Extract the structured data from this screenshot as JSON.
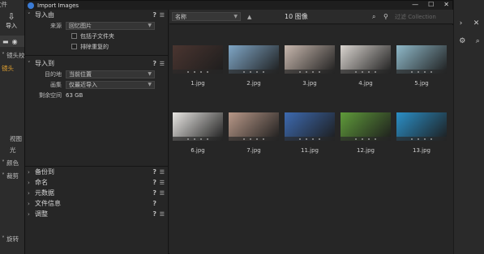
{
  "background_app": {
    "top_label": "文件",
    "import_label": "导入",
    "lens_label": "镜头校",
    "tab_label": "镜头",
    "side_labels": [
      "视图",
      "光",
      "颜色",
      "裁剪",
      "旋转"
    ]
  },
  "dialog": {
    "title": "Import Images",
    "window_buttons": [
      "—",
      "☐",
      "✕"
    ]
  },
  "left_panel": {
    "import_from": {
      "header": "导入由",
      "source_label": "来源",
      "source_value": "回忆图片",
      "include_subfolders": "包括子文件夹",
      "exclude_duplicates": "排除重复的"
    },
    "import_to": {
      "header": "导入到",
      "destination_label": "目的地",
      "destination_value": "当前位置",
      "album_label": "画集",
      "album_value": "仅最近导入",
      "free_space_label": "剩余空间",
      "free_space_value": "63 GB"
    },
    "collapsed_sections": [
      "备份到",
      "命名",
      "元数据",
      "文件信息",
      "调整"
    ]
  },
  "toolbar": {
    "sort_value": "名称",
    "sort_direction_icon": "▲",
    "count": "10 图像",
    "search_placeholder": "过滤 Collection"
  },
  "thumbnails": [
    {
      "name": "1.jpg",
      "color": "#4a3530"
    },
    {
      "name": "2.jpg",
      "color": "#7fa6c6"
    },
    {
      "name": "3.jpg",
      "color": "#c8b8ae"
    },
    {
      "name": "4.jpg",
      "color": "#d9d4cf"
    },
    {
      "name": "5.jpg",
      "color": "#8fb9c9"
    },
    {
      "name": "6.jpg",
      "color": "#e8e6e3"
    },
    {
      "name": "7.jpg",
      "color": "#b89888"
    },
    {
      "name": "11.jpg",
      "color": "#3d6ab0"
    },
    {
      "name": "12.jpg",
      "color": "#5f9a3a"
    },
    {
      "name": "13.jpg",
      "color": "#2b8fc7"
    }
  ]
}
